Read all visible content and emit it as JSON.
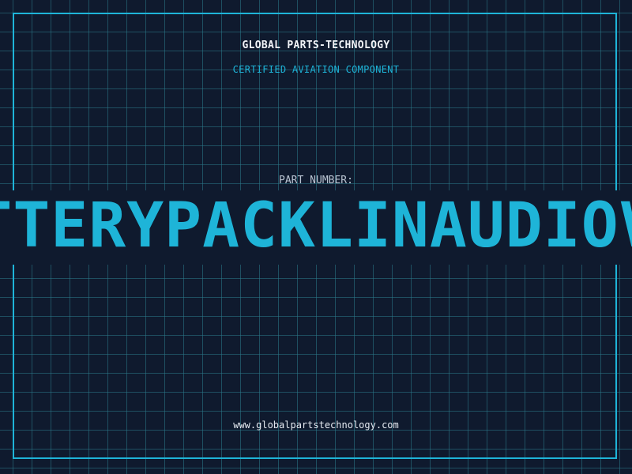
{
  "header": {
    "company": "GLOBAL PARTS-TECHNOLOGY",
    "subtitle": "CERTIFIED AVIATION COMPONENT"
  },
  "part": {
    "label": "PART NUMBER:",
    "number": "BATTERYPACKLINAUDIOVIS"
  },
  "footer": {
    "website": "www.globalpartstechnology.com"
  },
  "colors": {
    "background": "#0f1a2e",
    "accent": "#1eb4d8",
    "grid": "#2b7a8a"
  }
}
